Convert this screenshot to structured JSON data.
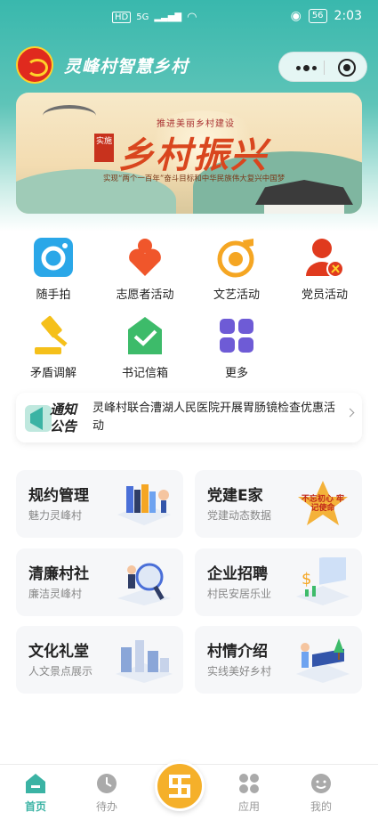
{
  "status_bar": {
    "network": "5G",
    "hd": "HD",
    "battery": "56",
    "time": "2:03"
  },
  "header": {
    "app_title": "灵峰村智慧乡村"
  },
  "banner": {
    "subtitle": "推进美丽乡村建设",
    "title": "乡村振兴",
    "stamp": "实施",
    "description": "实现“两个一百年”奋斗目标和中华民族伟大复兴中国梦"
  },
  "grid": {
    "items": [
      {
        "label": "随手拍",
        "icon": "camera-icon"
      },
      {
        "label": "志愿者活动",
        "icon": "heart-icon"
      },
      {
        "label": "文艺活动",
        "icon": "music-icon"
      },
      {
        "label": "党员活动",
        "icon": "party-member-icon"
      },
      {
        "label": "矛盾调解",
        "icon": "gavel-icon"
      },
      {
        "label": "书记信箱",
        "icon": "mailbox-icon"
      },
      {
        "label": "更多",
        "icon": "more-grid-icon"
      }
    ]
  },
  "notice": {
    "badge_line1": "通知",
    "badge_line2": "公告",
    "text": "灵峰村联合漕湖人民医院开展胃肠镜检查优惠活动"
  },
  "cards": [
    {
      "title": "规约管理",
      "subtitle": "魅力灵峰村"
    },
    {
      "title": "党建E家",
      "subtitle": "党建动态数据",
      "art_text": "不忘初心 牢记使命"
    },
    {
      "title": "清廉村社",
      "subtitle": "廉洁灵峰村"
    },
    {
      "title": "企业招聘",
      "subtitle": "村民安居乐业"
    },
    {
      "title": "文化礼堂",
      "subtitle": "人文景点展示"
    },
    {
      "title": "村情介绍",
      "subtitle": "实线美好乡村"
    }
  ],
  "tabbar": {
    "tabs": [
      {
        "label": "首页",
        "icon": "home-icon"
      },
      {
        "label": "待办",
        "icon": "clock-icon"
      },
      {
        "label": "应用",
        "icon": "apps-icon"
      },
      {
        "label": "我的",
        "icon": "profile-icon"
      }
    ],
    "active": "首页"
  },
  "colors": {
    "primary": "#3bb3a4",
    "accent": "#f5b02a",
    "party_red": "#e03a1e"
  }
}
